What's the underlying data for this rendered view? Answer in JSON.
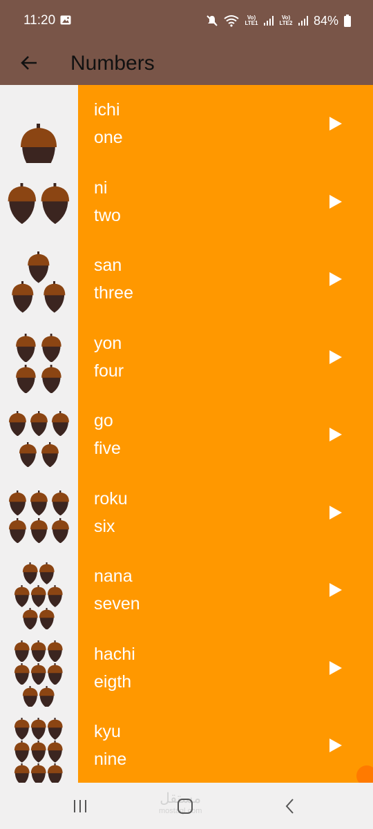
{
  "status_bar": {
    "time": "11:20",
    "battery": "84%",
    "sim1_label": "Vo) LTE1",
    "sim2_label": "Vo) LTE2"
  },
  "app_bar": {
    "title": "Numbers",
    "back_icon": "arrow-back-icon"
  },
  "colors": {
    "app_bar": "#795548",
    "list_item": "#ff9800",
    "acorn_cap": "#8b4513",
    "acorn_body": "#3b2520"
  },
  "numbers": [
    {
      "japanese": "ichi",
      "english": "one",
      "count": 1
    },
    {
      "japanese": "ni",
      "english": "two",
      "count": 2
    },
    {
      "japanese": "san",
      "english": "three",
      "count": 3
    },
    {
      "japanese": "yon",
      "english": "four",
      "count": 4
    },
    {
      "japanese": "go",
      "english": "five",
      "count": 5
    },
    {
      "japanese": "roku",
      "english": "six",
      "count": 6
    },
    {
      "japanese": "nana",
      "english": "seven",
      "count": 7
    },
    {
      "japanese": "hachi",
      "english": "eigth",
      "count": 8
    },
    {
      "japanese": "kyu",
      "english": "nine",
      "count": 9
    }
  ],
  "watermark": {
    "arabic": "مستقل",
    "latin": "mostaql.com"
  },
  "nav_bar": {
    "recents_icon": "recents-icon",
    "home_icon": "home-icon",
    "back_icon": "nav-back-icon"
  }
}
